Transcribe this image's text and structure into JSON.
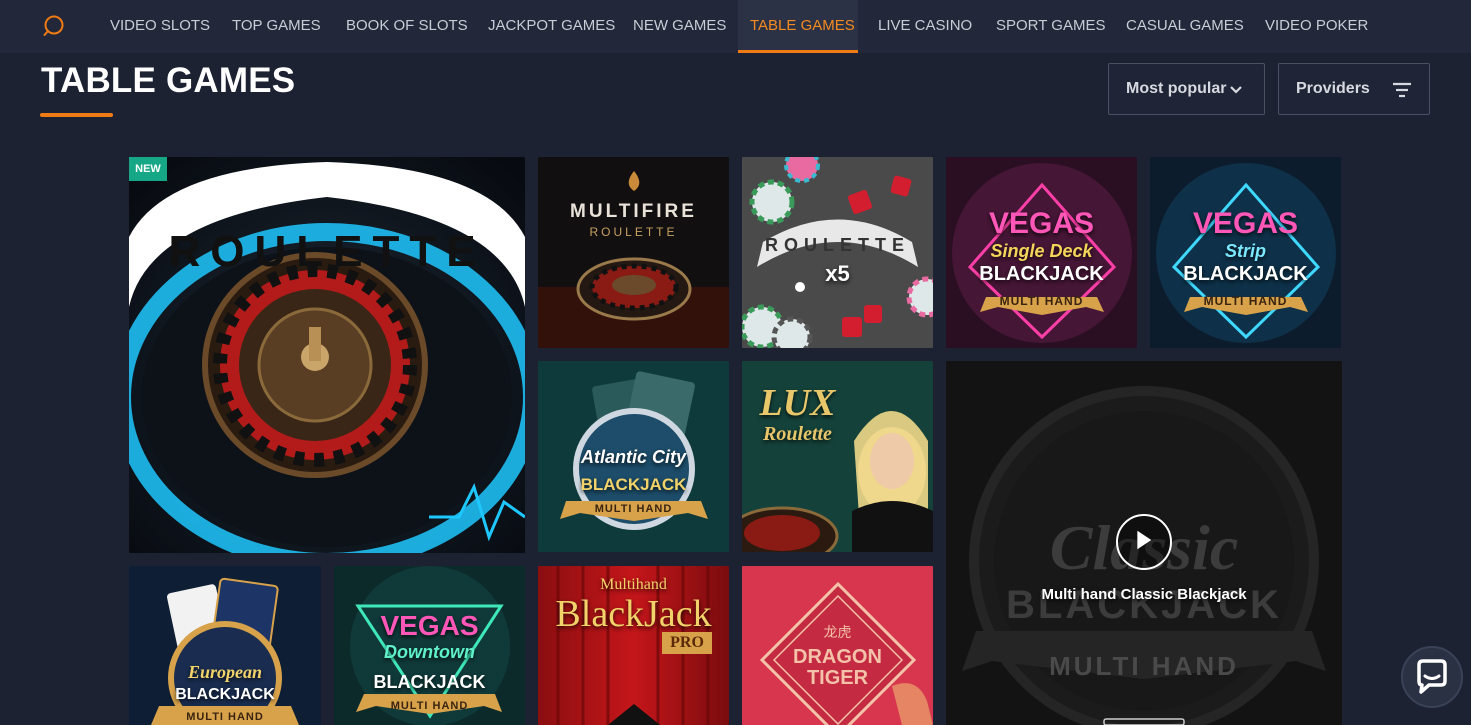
{
  "nav": {
    "items": [
      {
        "label": "VIDEO SLOTS"
      },
      {
        "label": "TOP GAMES"
      },
      {
        "label": "BOOK OF SLOTS"
      },
      {
        "label": "JACKPOT GAMES"
      },
      {
        "label": "NEW GAMES"
      },
      {
        "label": "TABLE GAMES",
        "active": true
      },
      {
        "label": "LIVE CASINO"
      },
      {
        "label": "SPORT GAMES"
      },
      {
        "label": "CASUAL GAMES"
      },
      {
        "label": "VIDEO POKER"
      }
    ]
  },
  "page": {
    "title": "TABLE GAMES"
  },
  "sort": {
    "label": "Most popular"
  },
  "filter": {
    "label": "Providers"
  },
  "badge": {
    "new": "NEW"
  },
  "colors": {
    "accent": "#f07a14",
    "badge": "#16a886",
    "background": "#1d2232"
  },
  "tiles": {
    "roulette": {
      "text": "ROULETTE"
    },
    "multifire": {
      "line1": "MULTIFIRE",
      "line2": "ROULETTE"
    },
    "roulette_x5": {
      "line1": "ROULETTE",
      "line2": "x5"
    },
    "vegas_single": {
      "line1": "VEGAS",
      "line2": "Single Deck",
      "line3": "BLACKJACK",
      "ribbon": "MULTI HAND"
    },
    "vegas_strip": {
      "line1": "VEGAS",
      "line2": "Strip",
      "line3": "BLACKJACK",
      "ribbon": "MULTI HAND"
    },
    "atlantic": {
      "line1": "Atlantic City",
      "line2": "BLACKJACK",
      "ribbon": "MULTI HAND"
    },
    "lux": {
      "line1": "LUX",
      "line2": "Roulette"
    },
    "classic": {
      "bg1": "Classic",
      "bg2": "BLACKJACK",
      "bg3": "MULTI HAND",
      "hover_title": "Multi hand Classic Blackjack"
    },
    "european": {
      "line1": "European",
      "line2": "BLACKJACK",
      "ribbon": "MULTI HAND"
    },
    "vegas_downtown": {
      "line1": "VEGAS",
      "line2": "Downtown",
      "line3": "BLACKJACK",
      "ribbon": "MULTI HAND"
    },
    "multihand_pro": {
      "line1": "Multihand",
      "line2": "BlackJack",
      "line3": "PRO"
    },
    "dragon": {
      "line0": "龙虎",
      "line1": "DRAGON",
      "line2": "TIGER"
    }
  },
  "icons": {
    "search": "search-icon",
    "chevron": "chevron-down-icon",
    "filter": "filter-icon",
    "play": "play-icon",
    "chat": "chat-icon"
  }
}
